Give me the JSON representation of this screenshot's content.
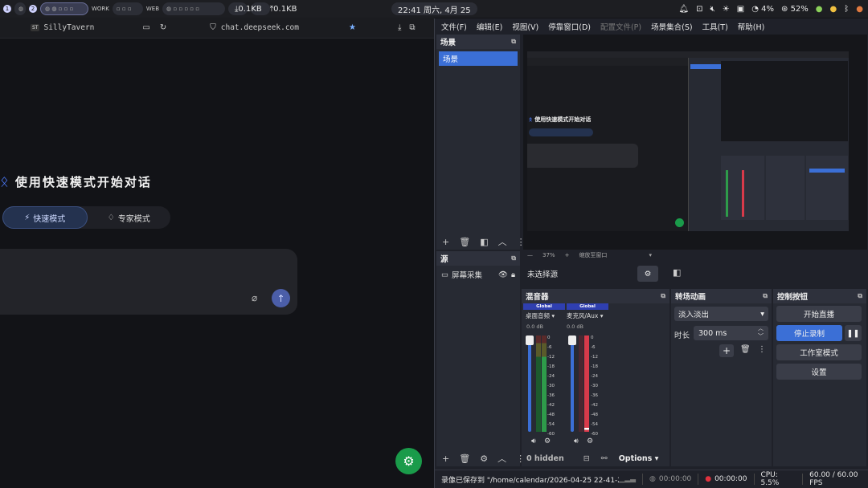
{
  "topbar": {
    "workspaces": [
      "1",
      "2"
    ],
    "ws_tags": [
      "WORK",
      "WEB"
    ],
    "download": "0.1KB",
    "upload": "0.1KB",
    "clock": "22:41 周六, 4月 25",
    "cpu_pct": "4%",
    "battery": "52%"
  },
  "browser": {
    "tab_badge": "ST",
    "tab_title": "SillyTavern",
    "url": "chat.deepseek.com"
  },
  "deepseek": {
    "hero": "使用快速模式开始对话",
    "mode_fast": "快速模式",
    "mode_expert": "专家模式"
  },
  "obs": {
    "menu": [
      "文件(F)",
      "编辑(E)",
      "视图(V)",
      "停靠窗口(D)",
      "配置文件(P)",
      "场景集合(S)",
      "工具(T)",
      "帮助(H)"
    ],
    "scenes_title": "场景",
    "scene_item": "场景",
    "sources_title": "源",
    "source_item": "屏幕采集",
    "zoom": "37%",
    "zoom_label": "缩放至窗口",
    "no_source": "未选择源",
    "mixer_title": "混音器",
    "ch1_tag": "Global",
    "ch1_name": "桌面音频",
    "ch1_db": "0.0 dB",
    "ch2_tag": "Global",
    "ch2_name": "麦克风/Aux",
    "ch2_db": "0.0 dB",
    "ticks": [
      "0",
      "-6",
      "-12",
      "-18",
      "-24",
      "-30",
      "-36",
      "-42",
      "-48",
      "-54",
      "-60"
    ],
    "hidden": "0 hidden",
    "options": "Options",
    "transitions_title": "转场动画",
    "transition": "淡入淡出",
    "duration_label": "时长",
    "duration": "300 ms",
    "controls_title": "控制按钮",
    "start_stream": "开始直播",
    "stop_record": "停止录制",
    "studio_mode": "工作室模式",
    "settings": "设置",
    "status_saved": "录像已保存到 \"/home/calendar/2026-04-25 22-41-21.m",
    "stream_time": "00:00:00",
    "rec_time": "00:00:00",
    "cpu": "CPU: 5.5%",
    "fps": "60.00 / 60.00 FPS"
  },
  "mini_preview": {
    "hero": "使用快速模式开始对话"
  },
  "colors": {
    "accent": "#3b6fd6",
    "rec": "#e0323e",
    "meter_green": "#2e9b4a",
    "meter_red": "#d83a4a",
    "fab": "#1a9b4a"
  }
}
